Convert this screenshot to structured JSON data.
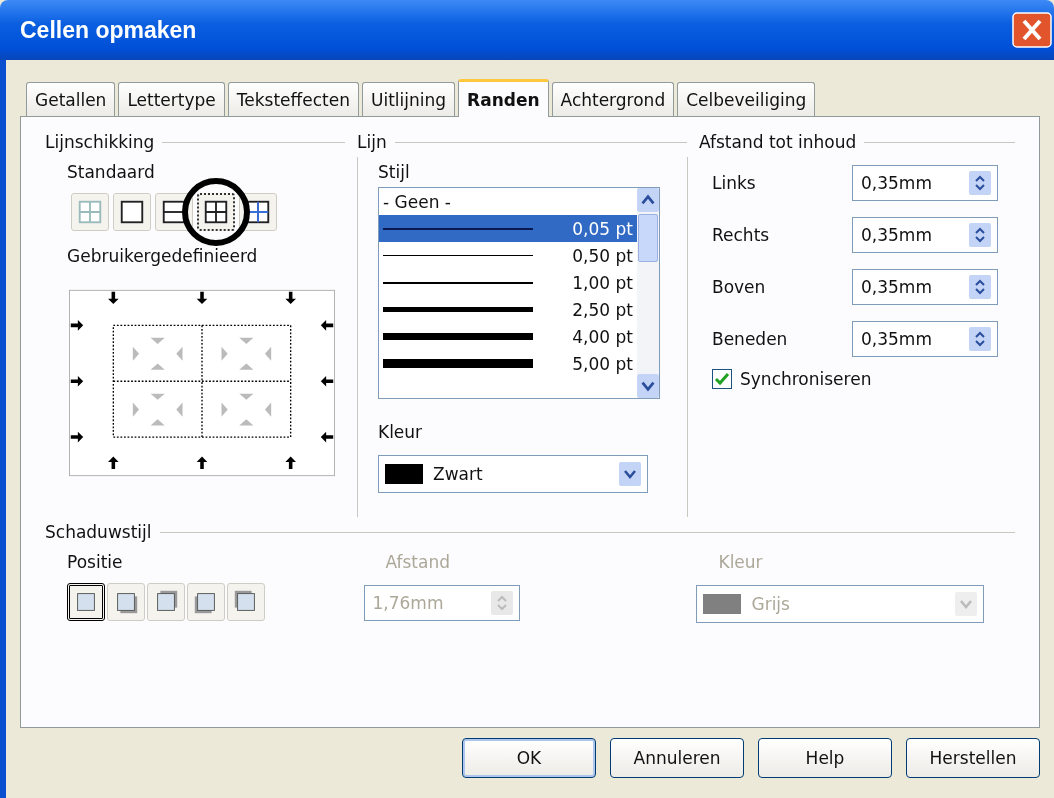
{
  "window": {
    "title": "Cellen opmaken"
  },
  "tabs": [
    {
      "label": "Getallen",
      "selected": false
    },
    {
      "label": "Lettertype",
      "selected": false
    },
    {
      "label": "Teksteffecten",
      "selected": false
    },
    {
      "label": "Uitlijning",
      "selected": false
    },
    {
      "label": "Randen",
      "selected": true
    },
    {
      "label": "Achtergrond",
      "selected": false
    },
    {
      "label": "Celbeveiliging",
      "selected": false
    }
  ],
  "line_arrangement": {
    "title": "Lijnschikking",
    "default_label": "Standaard",
    "presets": [
      {
        "kind": "none",
        "selected": false
      },
      {
        "kind": "outer",
        "selected": false
      },
      {
        "kind": "outer-horizontal",
        "selected": false
      },
      {
        "kind": "outer-all",
        "selected": true
      },
      {
        "kind": "outer-inner",
        "selected": false
      }
    ],
    "custom_label": "Gebruikergedefinieerd"
  },
  "line": {
    "title": "Lijn",
    "style_label": "Stijl",
    "styles": [
      {
        "kind": "none",
        "label": "- Geen -",
        "selected": false
      },
      {
        "kind": "line",
        "label": "0,05 pt",
        "selected": true
      },
      {
        "kind": "line",
        "label": "0,50 pt",
        "selected": false
      },
      {
        "kind": "line",
        "label": "1,00 pt",
        "selected": false
      },
      {
        "kind": "line",
        "label": "2,50 pt",
        "selected": false
      },
      {
        "kind": "line",
        "label": "4,00 pt",
        "selected": false
      },
      {
        "kind": "line",
        "label": "5,00 pt",
        "selected": false
      }
    ],
    "color_label": "Kleur",
    "color": {
      "value": "Zwart",
      "color": "#000000"
    }
  },
  "spacing": {
    "title": "Afstand tot inhoud",
    "fields": [
      {
        "label": "Links",
        "value": "0,35mm"
      },
      {
        "label": "Rechts",
        "value": "0,35mm"
      },
      {
        "label": "Boven",
        "value": "0,35mm"
      },
      {
        "label": "Beneden",
        "value": "0,35mm"
      }
    ],
    "synchronize": {
      "label": "Synchroniseren",
      "checked": true
    }
  },
  "shadow": {
    "title": "Schaduwstijl",
    "position_label": "Positie",
    "positions": [
      {
        "kind": "none",
        "selected": true
      },
      {
        "kind": "bottom-right",
        "selected": false
      },
      {
        "kind": "top-right",
        "selected": false
      },
      {
        "kind": "bottom-left",
        "selected": false
      },
      {
        "kind": "top-left",
        "selected": false
      }
    ],
    "distance": {
      "label": "Afstand",
      "value": "1,76mm",
      "disabled": true
    },
    "color": {
      "label": "Kleur",
      "value": "Grijs",
      "color": "#808080",
      "disabled": true
    }
  },
  "buttons": [
    {
      "label": "OK"
    },
    {
      "label": "Annuleren"
    },
    {
      "label": "Help"
    },
    {
      "label": "Herstellen"
    }
  ]
}
